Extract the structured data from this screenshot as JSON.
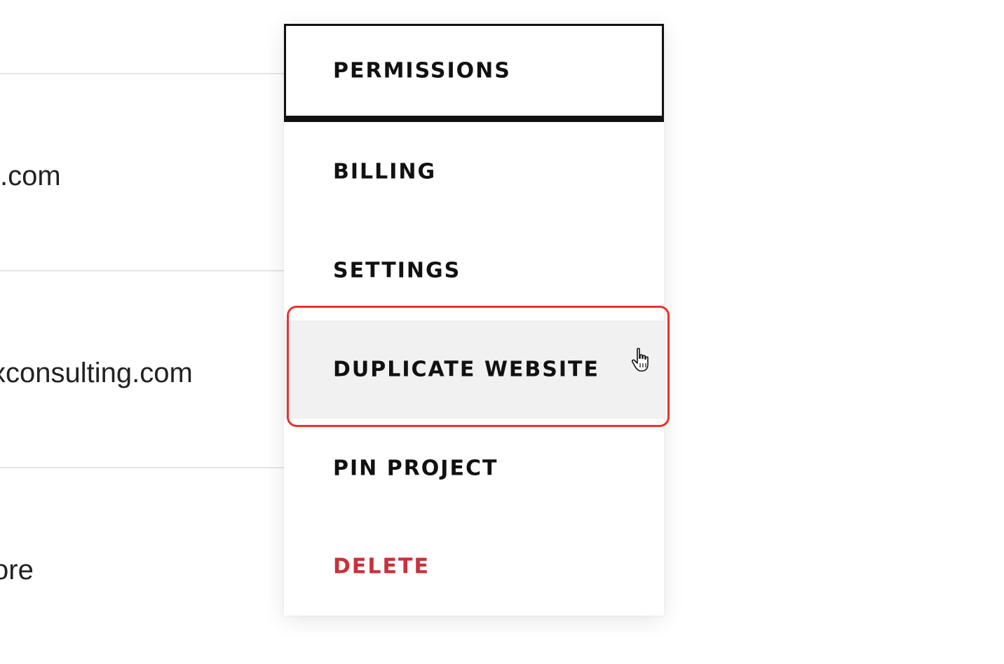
{
  "background_rows": [
    {
      "text": ".com"
    },
    {
      "text": "xconsulting.com"
    },
    {
      "text": "ore"
    }
  ],
  "menu": {
    "items": [
      {
        "label": "PERMISSIONS",
        "state": "focused"
      },
      {
        "label": "BILLING",
        "state": "normal"
      },
      {
        "label": "SETTINGS",
        "state": "normal"
      },
      {
        "label": "DUPLICATE WEBSITE",
        "state": "hovered"
      },
      {
        "label": "PIN PROJECT",
        "state": "normal"
      },
      {
        "label": "DELETE",
        "state": "danger"
      }
    ]
  },
  "colors": {
    "text": "#111111",
    "danger": "#c8313b",
    "hover_bg": "#f1f1f1",
    "highlight": "#e9332c",
    "divider": "#e5e5e5"
  },
  "icons": {
    "cursor": "pointer-hand-icon"
  }
}
